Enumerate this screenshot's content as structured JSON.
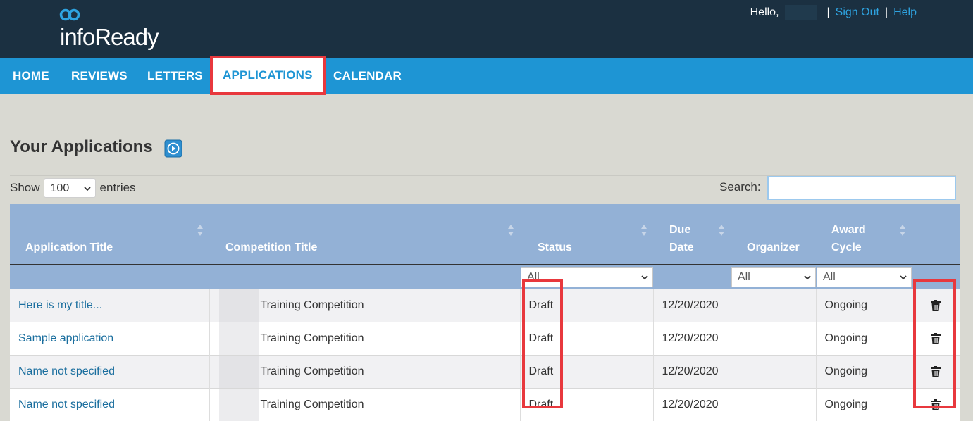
{
  "header": {
    "logo_text": "infoReady",
    "greeting": "Hello,",
    "sign_out": "Sign Out",
    "help": "Help",
    "separator": "|"
  },
  "nav": {
    "items": [
      {
        "label": "HOME"
      },
      {
        "label": "REVIEWS"
      },
      {
        "label": "LETTERS"
      },
      {
        "label": "APPLICATIONS",
        "active": true
      },
      {
        "label": "CALENDAR"
      }
    ]
  },
  "page": {
    "title": "Your Applications",
    "show_label": "Show",
    "entries_value": "100",
    "entries_label": "entries",
    "search_label": "Search:",
    "search_value": ""
  },
  "table": {
    "columns": [
      "Application Title",
      "Competition Title",
      "Status",
      "Due Date",
      "Organizer",
      "Award Cycle"
    ],
    "due_date_lines": [
      "Due",
      "Date"
    ],
    "award_cycle_lines": [
      "Award",
      "Cycle"
    ],
    "filters": {
      "status": "All",
      "organizer": "All",
      "award_cycle": "All"
    },
    "rows": [
      {
        "app_title": "Here is my title...",
        "competition": "Training Competition",
        "status": "Draft",
        "due_date": "12/20/2020",
        "organizer": "",
        "award_cycle": "Ongoing"
      },
      {
        "app_title": "Sample application",
        "competition": "Training Competition",
        "status": "Draft",
        "due_date": "12/20/2020",
        "organizer": "",
        "award_cycle": "Ongoing"
      },
      {
        "app_title": "Name not specified",
        "competition": "Training Competition",
        "status": "Draft",
        "due_date": "12/20/2020",
        "organizer": "",
        "award_cycle": "Ongoing"
      },
      {
        "app_title": "Name not specified",
        "competition": "Training Competition",
        "status": "Draft",
        "due_date": "12/20/2020",
        "organizer": "",
        "award_cycle": "Ongoing"
      }
    ]
  },
  "colors": {
    "topbar": "#1b3041",
    "nav": "#1e95d4",
    "table_header": "#93b1d6",
    "highlight": "#e8383d",
    "link": "#1a6e9e"
  }
}
